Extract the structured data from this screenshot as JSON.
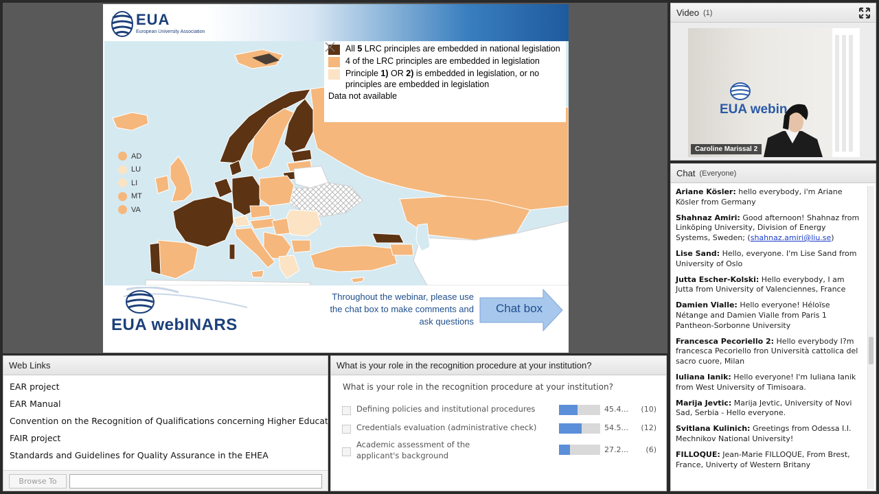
{
  "slide": {
    "legend": [
      {
        "text_pre": "All ",
        "text_bold": "5",
        "text_post": " LRC principles are embedded in national legislation",
        "color": "#5c3313"
      },
      {
        "text_pre": "4 of the LRC principles are embedded in legislation",
        "text_bold": "",
        "text_post": "",
        "color": "#f5b77c"
      },
      {
        "text_pre": "Principle ",
        "text_bold": "1)",
        "text_mid": " OR ",
        "text_bold2": "2)",
        "text_post": " is embedded in legislation, or no principles are embedded in legislation",
        "color": "#fbe3c4"
      },
      {
        "text_pre": "Data not available",
        "text_bold": "",
        "text_post": "",
        "color": "none"
      }
    ],
    "small_states": [
      {
        "label": "AD",
        "color": "#f5b77c"
      },
      {
        "label": "LU",
        "color": "#fbe3c4"
      },
      {
        "label": "LI",
        "color": "#fbe3c4"
      },
      {
        "label": "MT",
        "color": "#f5b77c"
      },
      {
        "label": "VA",
        "color": "#f5b77c"
      }
    ],
    "header_logo": "EUA",
    "header_logo_sub": "European University Association",
    "footer_logo": "EUA webINARS",
    "footer_message": "Throughout the webinar, please use the chat box to make comments and ask questions",
    "chat_box_label": "Chat box"
  },
  "video": {
    "title": "Video",
    "count": "(1)",
    "presenter": "Caroline Marissal 2",
    "wall_text": "EUA webin"
  },
  "chat": {
    "title": "Chat",
    "scope": "(Everyone)",
    "messages": [
      {
        "who": "Ariane Kösler:",
        "text": " hello everybody, i'm Ariane Kösler from Germany"
      },
      {
        "who": "Shahnaz Amiri:",
        "text": " Good afternoon! Shahnaz from Linköping University, Division of Energy Systems, Sweden; (",
        "link": "shahnaz.amiri@liu.se",
        "after": ")"
      },
      {
        "who": "Lise Sand:",
        "text": " Hello, everyone. I'm Lise Sand from University of Oslo"
      },
      {
        "who": "Jutta Escher-Kolski:",
        "text": " Hello everybody, I am Jutta from University of Valenciennes, France"
      },
      {
        "who": "Damien Vialle:",
        "text": " Hello everyone! Héloïse Nétange and Damien Vialle from Paris 1 Pantheon-Sorbonne University"
      },
      {
        "who": "Francesca Pecoriello 2:",
        "text": " Hello everybody I?m francesca Pecoriello fron Università cattolica del sacro cuore, Milan"
      },
      {
        "who": "Iuliana Ianik:",
        "text": " Hello everyone! I'm Iuliana Ianik from West University of Timisoara."
      },
      {
        "who": "Marija Jevtic:",
        "text": " Marija Jevtic, University of Novi Sad, Serbia - Hello everyone."
      },
      {
        "who": "Svitlana Kulinich:",
        "text": " Greetings from Odessa I.I. Mechnikov National University!"
      },
      {
        "who": "FILLOQUE:",
        "text": " Jean-Marie FILLOQUE, From Brest, France, Univerty of Western Britany"
      }
    ]
  },
  "links": {
    "title": "Web Links",
    "items": [
      "EAR project",
      "EAR Manual",
      "Convention on the Recognition of Qualifications concerning Higher Educati",
      "FAIR project",
      "Standards and Guidelines for Quality Assurance in the EHEA"
    ],
    "browse_label": "Browse To",
    "url_value": ""
  },
  "poll": {
    "title": "What is your role in the recognition procedure at your institution?",
    "question": "What is your role in the recognition procedure at your institution?",
    "options": [
      {
        "label": "Defining policies and institutional procedures",
        "pct_text": "45.4...",
        "fraction": 0.454,
        "count": "(10)"
      },
      {
        "label": "Credentials evaluation (administrative check)",
        "pct_text": "54.5...",
        "fraction": 0.545,
        "count": "(12)"
      },
      {
        "label": "Academic assessment of the applicant's background",
        "pct_text": "27.2...",
        "fraction": 0.272,
        "count": "(6)"
      }
    ]
  },
  "colors": {
    "dark_brown": "#5c3313",
    "orange": "#f5b77c",
    "light_peach": "#fbe3c4",
    "sea": "#d5e9f1",
    "poll_bar": "#5b8fd8"
  }
}
